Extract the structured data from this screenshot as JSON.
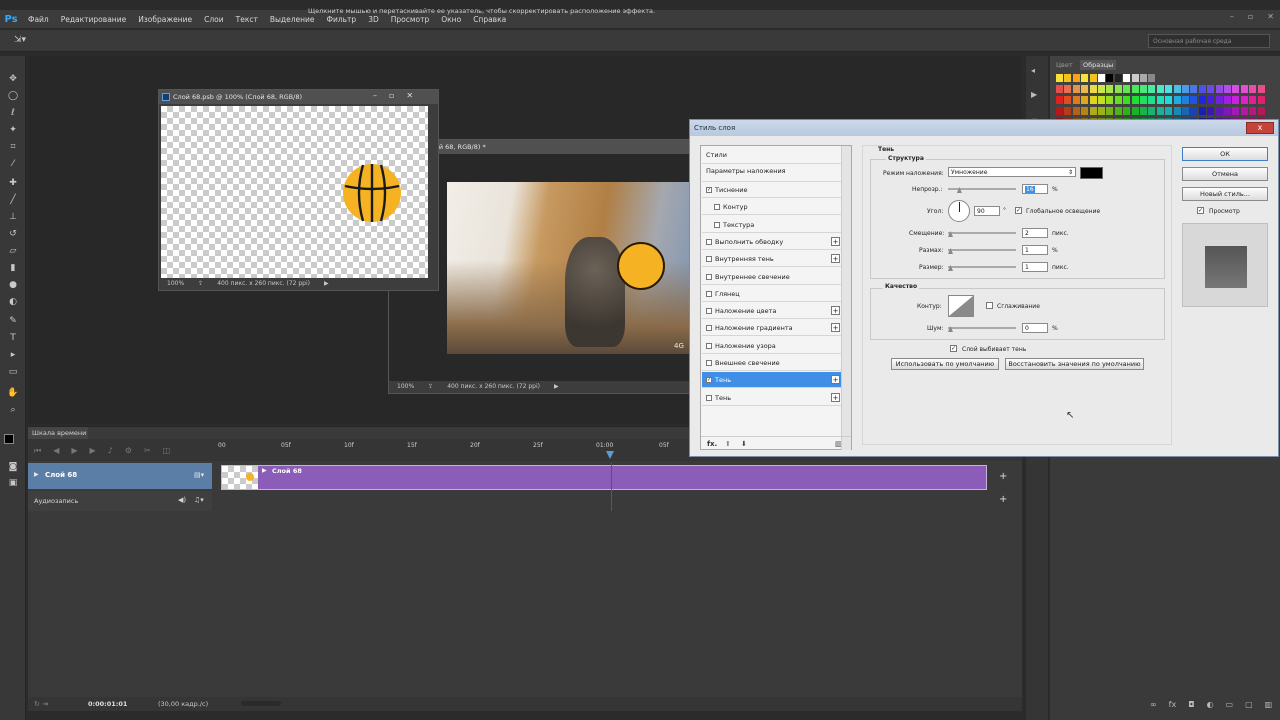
{
  "menubar": {
    "logo": "Ps",
    "items": [
      "Файл",
      "Редактирование",
      "Изображение",
      "Слои",
      "Текст",
      "Выделение",
      "Фильтр",
      "3D",
      "Просмотр",
      "Окно",
      "Справка"
    ]
  },
  "options": {
    "hint": "Щелкните мышью и перетаскивайте ее указатель, чтобы скорректировать расположение эффекта.",
    "workspace": "Основная рабочая среда"
  },
  "doc1": {
    "title": "Слой 68.psb @ 100% (Слой 68, RGB/8)",
    "zoom": "100%",
    "size": "400 пикс. x 260 пикс. (72 ppi)"
  },
  "doc2": {
    "title": "100% (Слой 68, RGB/8) *",
    "zoom": "100%",
    "size": "400 пикс. x 260 пикс. (72 ppi)",
    "watermark": "4G"
  },
  "panels": {
    "tab_color": "Цвет",
    "tab_swatches": "Образцы"
  },
  "timeline": {
    "tab": "Шкала времени",
    "ruler": [
      "00",
      "05f",
      "10f",
      "15f",
      "20f",
      "25f",
      "01:00",
      "05f"
    ],
    "layer_name": "Слой 68",
    "clip_name": "Слой 68",
    "audio": "Аудиозапись",
    "timecode": "0:00:01:01",
    "fps": "(30,00 кадр./с)"
  },
  "dialog": {
    "title": "Стиль слоя",
    "close": "x",
    "styles_header": "Стили",
    "blend_options": "Параметры наложения",
    "items": [
      {
        "label": "Тиснение",
        "checked": true,
        "plus": false,
        "indent": false
      },
      {
        "label": "Контур",
        "checked": false,
        "plus": false,
        "indent": true
      },
      {
        "label": "Текстура",
        "checked": false,
        "plus": false,
        "indent": true
      },
      {
        "label": "Выполнить обводку",
        "checked": false,
        "plus": true,
        "indent": false
      },
      {
        "label": "Внутренняя тень",
        "checked": false,
        "plus": true,
        "indent": false
      },
      {
        "label": "Внутреннее свечение",
        "checked": false,
        "plus": false,
        "indent": false
      },
      {
        "label": "Глянец",
        "checked": false,
        "plus": false,
        "indent": false
      },
      {
        "label": "Наложение цвета",
        "checked": false,
        "plus": true,
        "indent": false
      },
      {
        "label": "Наложение градиента",
        "checked": false,
        "plus": true,
        "indent": false
      },
      {
        "label": "Наложение узора",
        "checked": false,
        "plus": false,
        "indent": false
      },
      {
        "label": "Внешнее свечение",
        "checked": false,
        "plus": false,
        "indent": false
      },
      {
        "label": "Тень",
        "checked": true,
        "plus": true,
        "indent": false,
        "selected": true
      },
      {
        "label": "Тень",
        "checked": false,
        "plus": true,
        "indent": false
      }
    ],
    "fx": "fx.",
    "section": "Тень",
    "structure": "Структура",
    "blend_mode_label": "Режим наложения:",
    "blend_mode_value": "Умножение",
    "opacity_label": "Непрозр.:",
    "opacity_value": "16",
    "opacity_pct": 0.16,
    "angle_label": "Угол:",
    "angle_value": "90",
    "angle_unit": "°",
    "global_light": "Глобальное освещение",
    "distance_label": "Смещение:",
    "distance_value": "2",
    "size_label": "Размах:",
    "size_value": "1",
    "size2_label": "Размер:",
    "size2_value": "1",
    "unit_px": "пикс.",
    "unit_pct": "%",
    "quality": "Качество",
    "contour_label": "Контур:",
    "antialias": "Сглаживание",
    "noise_label": "Шум:",
    "noise_value": "0",
    "knockout": "Слой выбивает тень",
    "default_btn": "Использовать по умолчанию",
    "reset_btn": "Восстановить значения по умолчанию",
    "ok": "ОК",
    "cancel": "Отмена",
    "new_style": "Новый стиль...",
    "preview": "Просмотр"
  },
  "colors": {
    "accent": "#3f8fe6",
    "clip": "#8b5db8",
    "ball": "#f5b323"
  }
}
